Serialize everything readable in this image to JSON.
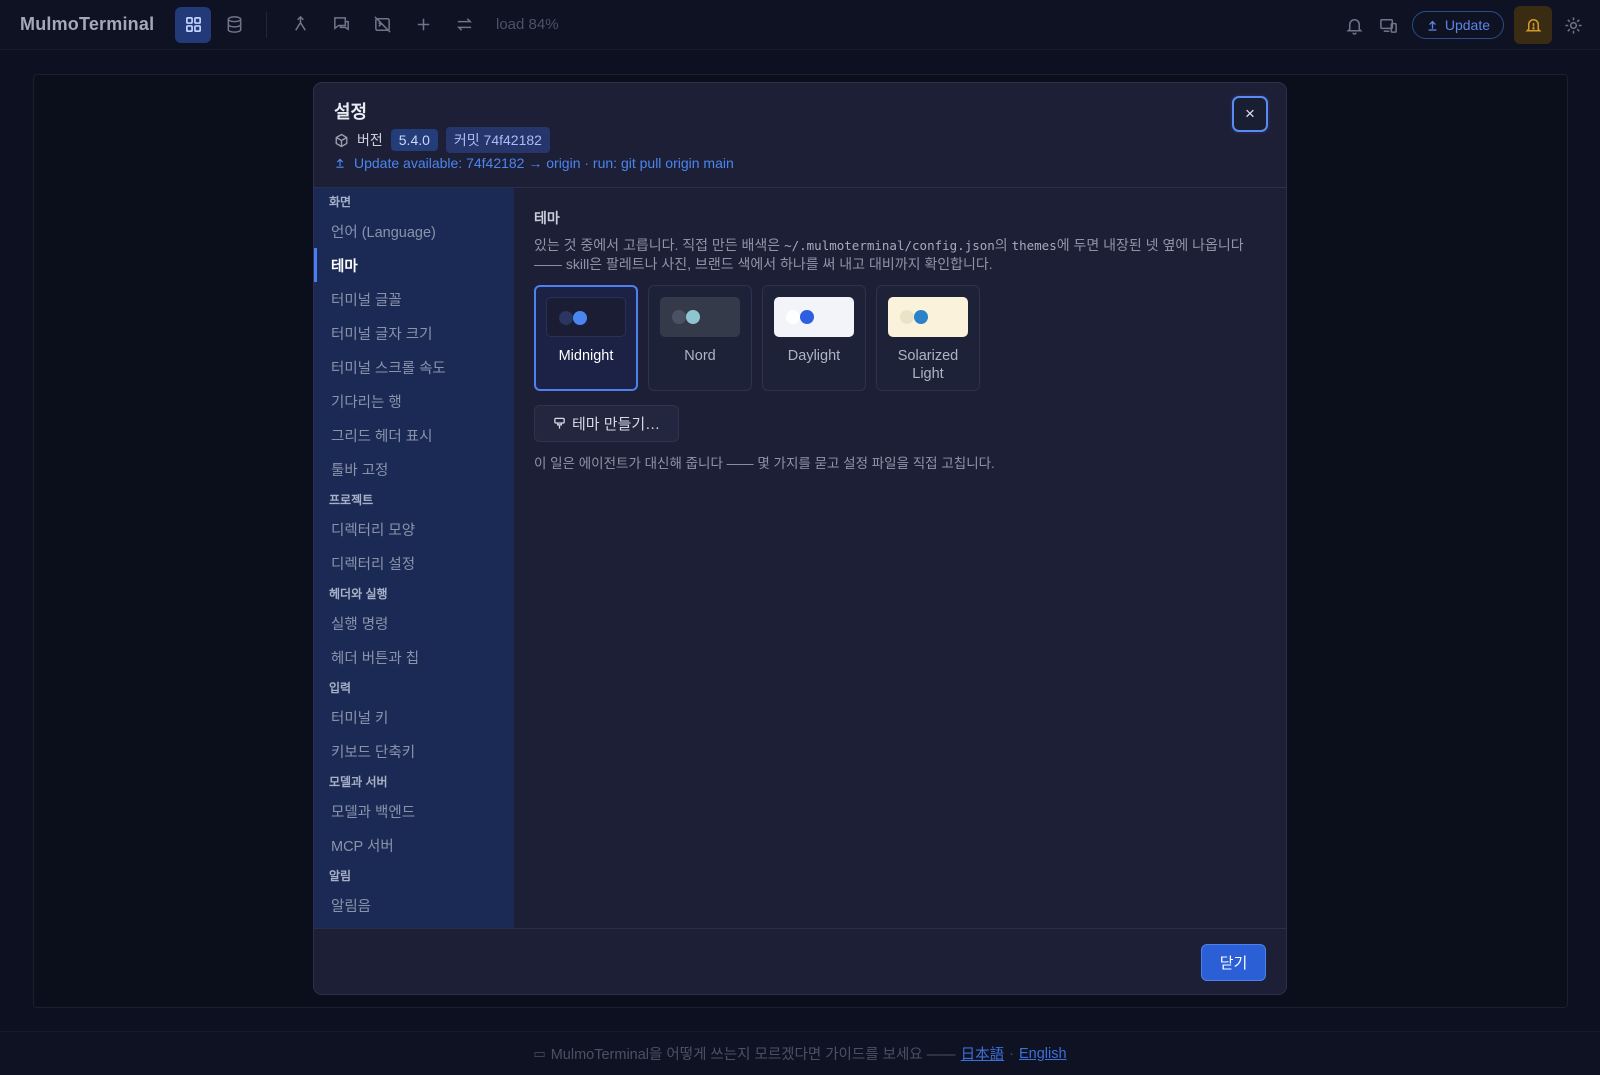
{
  "topbar": {
    "app_title": "MulmoTerminal",
    "load_label": "load 84%",
    "update_label": "Update",
    "icons": [
      "grid-icon",
      "database-icon",
      "merge-icon",
      "chat-icon",
      "terminal-off-icon",
      "plus-icon",
      "swap-icon",
      "bell-icon",
      "devices-icon",
      "upload-icon",
      "bell-warning-icon",
      "gear-icon"
    ],
    "accent": "#223a78"
  },
  "dialog": {
    "title": "설정",
    "version_label": "버전",
    "version": "5.4.0",
    "commit": "커밋 74f42182",
    "update_notice": "Update available: 74f42182 → origin · run: git pull origin main",
    "close_label": "×",
    "done_label": "닫기"
  },
  "sidebar": {
    "sections": [
      {
        "label": "화면",
        "items": [
          "언어 (Language)",
          "테마",
          "터미널 글꼴",
          "터미널 글자 크기",
          "터미널 스크롤 속도",
          "기다리는 행",
          "그리드 헤더 표시",
          "툴바 고정"
        ]
      },
      {
        "label": "프로젝트",
        "items": [
          "디렉터리 모양",
          "디렉터리 설정"
        ]
      },
      {
        "label": "헤더와 실행",
        "items": [
          "실행 명령",
          "헤더 버튼과 칩"
        ]
      },
      {
        "label": "입력",
        "items": [
          "터미널 키",
          "키보드 단축키"
        ]
      },
      {
        "label": "모델과 서버",
        "items": [
          "모델과 백엔드",
          "MCP 서버"
        ]
      },
      {
        "label": "알림",
        "items": [
          "알림음"
        ]
      }
    ],
    "active_item": "테마"
  },
  "content": {
    "title": "테마",
    "desc_part1": "있는 것 중에서 고릅니다. 직접 만든 배색은 ",
    "desc_code1": "~/.mulmoterminal/config.json",
    "desc_part2": "의 ",
    "desc_code2": "themes",
    "desc_part3": "에 두면 내장된 넷 옆에 나옵니다 —— skill은 팔레트나 사진, 브랜드 색에서 하나를 써 내고 대비까지 확인합니다.",
    "themes": [
      {
        "name": "Midnight",
        "bg": "#1a1d33",
        "dot1": "#2a3560",
        "dot2": "#4a86f0",
        "selected": true
      },
      {
        "name": "Nord",
        "bg": "#343a4a",
        "dot1": "#4a5162",
        "dot2": "#8ec6d0",
        "selected": false
      },
      {
        "name": "Daylight",
        "bg": "#f2f4fa",
        "dot1": "#ffffff",
        "dot2": "#2f5fe0",
        "selected": false
      },
      {
        "name": "Solarized Light",
        "bg": "#fbf2dc",
        "dot1": "#ece2c8",
        "dot2": "#2a82c8",
        "selected": false
      }
    ],
    "make_theme_label": "테마 만들기…",
    "make_theme_note": "이 일은 에이전트가 대신해 줍니다 —— 몇 가지를 묻고 설정 파일을 직접 고칩니다."
  },
  "footer": {
    "text": "MulmoTerminal을 어떻게 쓰는지 모르겠다면 가이드를 보세요 ——",
    "link_ja": "日本語",
    "separator": "·",
    "link_en": "English"
  }
}
